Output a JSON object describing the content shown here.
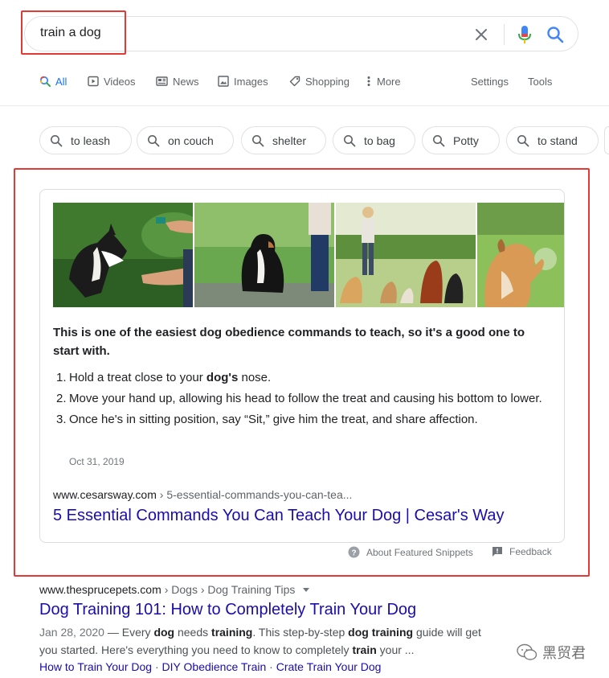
{
  "search": {
    "query": "train a dog"
  },
  "tabs": [
    {
      "label": "All",
      "icon": "search-icon"
    },
    {
      "label": "Videos",
      "icon": "video-icon"
    },
    {
      "label": "News",
      "icon": "news-icon"
    },
    {
      "label": "Images",
      "icon": "image-icon"
    },
    {
      "label": "Shopping",
      "icon": "tag-icon"
    },
    {
      "label": "More",
      "icon": "more-vert-icon"
    }
  ],
  "tools": {
    "settings": "Settings",
    "tools": "Tools"
  },
  "chips": [
    "to leash",
    "on couch",
    "shelter",
    "to bag",
    "Potty",
    "to stand"
  ],
  "snippet": {
    "heading": "This is one of the easiest dog obedience commands to teach, so it's a good one to start with.",
    "steps": [
      {
        "num": "1.",
        "before": "Hold a treat close to your ",
        "bold": "dog's",
        "after": " nose."
      },
      {
        "num": "2.",
        "before": "Move your hand up, allowing his head to follow the treat and causing his bottom to lower.",
        "bold": "",
        "after": ""
      },
      {
        "num": "3.",
        "before": "Once he's in sitting position, say “Sit,” give him the treat, and share affection.",
        "bold": "",
        "after": ""
      }
    ],
    "date": "Oct 31, 2019",
    "domain": "www.cesarsway.com",
    "path": " › 5-essential-commands-you-can-tea...",
    "title": "5 Essential Commands You Can Teach Your Dog | Cesar's Way",
    "about": "About Featured Snippets",
    "feedback": "Feedback"
  },
  "result": {
    "domain": "www.thesprucepets.com",
    "path": " › Dogs › Dog Training Tips",
    "title": "Dog Training 101: How to Completely Train Your Dog",
    "date": "Jan 28, 2020",
    "snippet_parts": [
      {
        "t": " — Every ",
        "b": false
      },
      {
        "t": "dog",
        "b": true
      },
      {
        "t": " needs ",
        "b": false
      },
      {
        "t": "training",
        "b": true
      },
      {
        "t": ". This step-by-step ",
        "b": false
      },
      {
        "t": "dog training",
        "b": true
      },
      {
        "t": " guide will get you started. Here's everything you need to know to completely ",
        "b": false
      },
      {
        "t": "train",
        "b": true
      },
      {
        "t": " your ...",
        "b": false
      }
    ],
    "sitelinks": [
      "How to Train Your Dog",
      "DIY Obedience Train",
      "Crate Train Your Dog"
    ],
    "sitelink_separator": " · "
  },
  "watermark": "黑贸君",
  "colors": {
    "link": "#1a0dab",
    "accent": "#1a73e8",
    "highlight_border": "#e53935"
  }
}
